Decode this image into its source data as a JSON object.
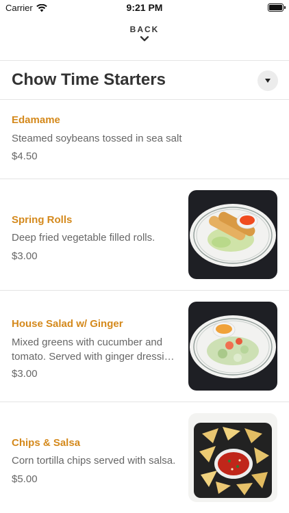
{
  "status_bar": {
    "carrier": "Carrier",
    "time": "9:21 PM"
  },
  "nav": {
    "back_label": "BACK"
  },
  "section": {
    "title": "Chow Time Starters"
  },
  "items": [
    {
      "name": "Edamame",
      "description": "Steamed soybeans tossed in sea salt",
      "price": "$4.50"
    },
    {
      "name": "Spring Rolls",
      "description": "Deep fried vegetable filled rolls.",
      "price": "$3.00",
      "image": "spring-rolls-photo"
    },
    {
      "name": "House Salad w/ Ginger",
      "description_line1": "Mixed greens with cucumber and",
      "description_line2": "tomato.  Served with ginger dressi…",
      "price": "$3.00",
      "image": "house-salad-photo"
    },
    {
      "name": "Chips & Salsa",
      "description": "Corn tortilla chips served with salsa.",
      "price": "$5.00",
      "image": "chips-salsa-photo"
    }
  ],
  "colors": {
    "accent": "#d4891c",
    "text": "#333333",
    "muted": "#666666",
    "divider": "#e4e4e4"
  }
}
